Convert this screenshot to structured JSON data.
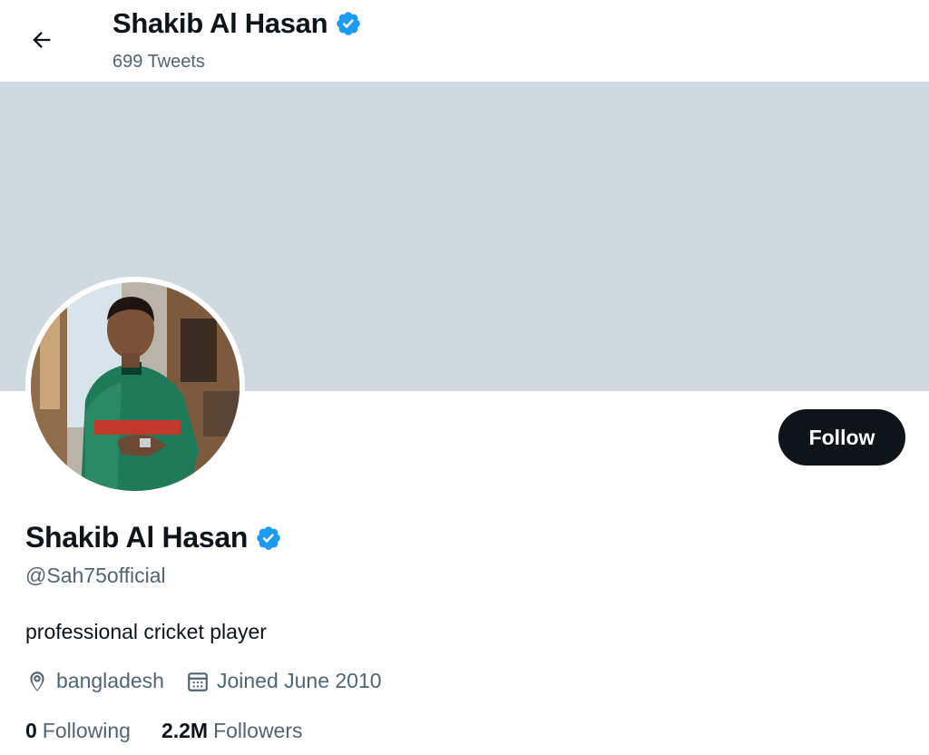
{
  "header": {
    "name": "Shakib Al Hasan",
    "tweet_count": "699 Tweets"
  },
  "profile": {
    "name": "Shakib Al Hasan",
    "handle": "@Sah75official",
    "bio": "professional cricket player",
    "location": "bangladesh",
    "joined": "Joined June 2010",
    "following_count": "0",
    "following_label": "Following",
    "followers_count": "2.2M",
    "followers_label": "Followers",
    "avatar_icon": "avatar-photo"
  },
  "actions": {
    "follow_label": "Follow"
  },
  "colors": {
    "banner": "#cfd9de",
    "verified": "#1d9bf0",
    "text_primary": "#0f1419",
    "text_secondary": "#536471",
    "follow_bg": "#0f1419"
  },
  "icons": {
    "back": "back-arrow-icon",
    "verified": "verified-badge-icon",
    "location": "location-pin-icon",
    "calendar": "calendar-icon"
  }
}
